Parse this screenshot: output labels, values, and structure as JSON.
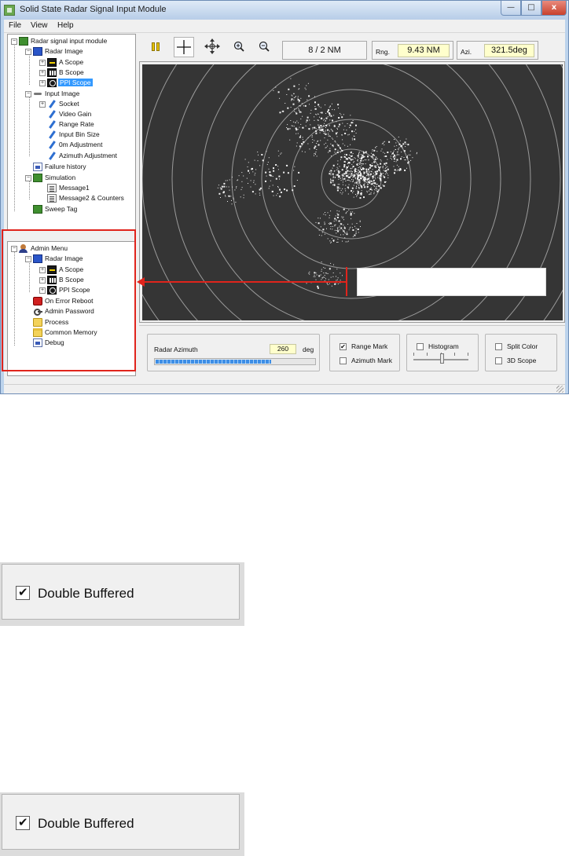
{
  "window": {
    "title": "Solid State Radar Signal Input Module",
    "controls": {
      "minimize": "—",
      "maximize": "□",
      "close": "x"
    }
  },
  "menu": [
    "File",
    "View",
    "Help"
  ],
  "tree_top": {
    "root": "Radar signal input module",
    "radar_image": "Radar Image",
    "a_scope": "A Scope",
    "b_scope": "B Scope",
    "ppi_scope": "PPI Scope",
    "input_image": "Input Image",
    "socket": "Socket",
    "video_gain": "Video Gain",
    "range_rate": "Range Rate",
    "input_bin_size": "Input Bin Size",
    "zero_m_adjustment": "0m Adjustment",
    "azimuth_adjustment": "Azimuth Adjustment",
    "failure_history": "Failure history",
    "simulation": "Simulation",
    "message1": "Message1",
    "message2": "Message2 & Counters",
    "sweep_tag": "Sweep Tag"
  },
  "tree_bottom": {
    "admin_menu": "Admin Menu",
    "radar_image": "Radar Image",
    "a_scope": "A Scope",
    "b_scope": "B Scope",
    "ppi_scope": "PPI Scope",
    "on_error_reboot": "On Error Reboot",
    "admin_password": "Admin Password",
    "process": "Process",
    "common_memory": "Common Memory",
    "debug": "Debug"
  },
  "toolbar": {
    "range_scale": "8 / 2 NM",
    "rng_label": "Rng.",
    "rng_value": "9.43 NM",
    "azi_label": "Azi.",
    "azi_value": "321.5deg"
  },
  "controls": {
    "radar_azimuth_label": "Radar Azimuth",
    "radar_azimuth_value": "260",
    "radar_azimuth_unit": "deg",
    "azimuth_progress": 0.72,
    "range_mark_label": "Range Mark",
    "range_mark_checked": true,
    "azimuth_mark_label": "Azimuth Mark",
    "azimuth_mark_checked": false,
    "histogram_label": "Histogram",
    "histogram_checked": false,
    "histogram_slider": 0.52,
    "split_color_label": "Split Color",
    "split_color_checked": false,
    "scope_3d_label": "3D Scope",
    "scope_3d_checked": false
  },
  "snippets": [
    {
      "label": "Double Buffered",
      "checked": true
    },
    {
      "label": "Double Buffered",
      "checked": true
    }
  ],
  "colors": {
    "highlight": "#e0241c",
    "selection": "#3399ff",
    "readout_bg": "#ffffcc",
    "radar_bg": "#353535"
  }
}
